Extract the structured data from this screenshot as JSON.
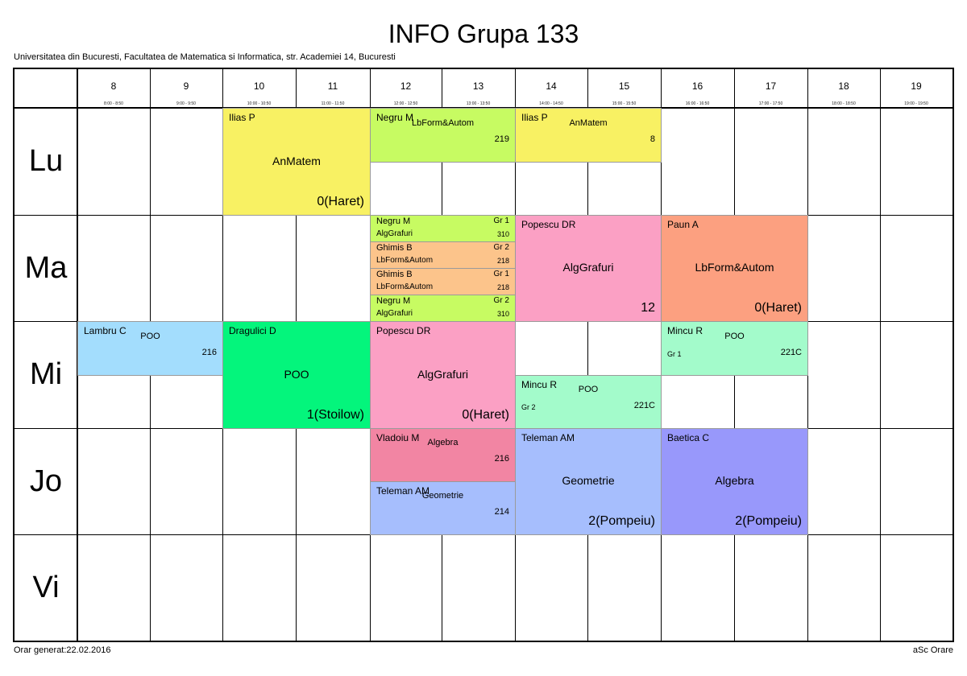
{
  "title": "INFO Grupa 133",
  "subtitle": "Universitatea din Bucuresti, Facultatea de Matematica si Informatica, str. Academiei 14, Bucuresti",
  "hours": [
    {
      "label": "8",
      "range": "8:00 - 8:50"
    },
    {
      "label": "9",
      "range": "9:00 - 9:50"
    },
    {
      "label": "10",
      "range": "10:00 - 10:50"
    },
    {
      "label": "11",
      "range": "11:00 - 11:50"
    },
    {
      "label": "12",
      "range": "12:00 - 12:50"
    },
    {
      "label": "13",
      "range": "13:00 - 13:50"
    },
    {
      "label": "14",
      "range": "14:00 - 14:50"
    },
    {
      "label": "15",
      "range": "15:00 - 15:50"
    },
    {
      "label": "16",
      "range": "16:00 - 16:50"
    },
    {
      "label": "17",
      "range": "17:00 - 17:50"
    },
    {
      "label": "18",
      "range": "18:00 - 18:50"
    },
    {
      "label": "19",
      "range": "19:00 - 19:50"
    }
  ],
  "days": [
    "Lu",
    "Ma",
    "Mi",
    "Jo",
    "Vi"
  ],
  "classes": [
    {
      "id": "lu-anmatem-1",
      "teacher": "Ilias P",
      "subject": "AnMatem",
      "room": "0(Haret)",
      "group": "",
      "color": "#f8f163"
    },
    {
      "id": "lu-lbform",
      "teacher": "Negru M",
      "subject": "LbForm&Autom",
      "room": "219",
      "group": "",
      "color": "#c7fb62"
    },
    {
      "id": "lu-anmatem-2",
      "teacher": "Ilias P",
      "subject": "AnMatem",
      "room": "8",
      "group": "",
      "color": "#f8f163"
    },
    {
      "id": "ma-alg-negru-1",
      "teacher": "Negru M",
      "subject": "AlgGrafuri",
      "room": "310",
      "group": "Gr 1",
      "color": "#c7fb62"
    },
    {
      "id": "ma-lbform-ghimis-2",
      "teacher": "Ghimis B",
      "subject": "LbForm&Autom",
      "room": "218",
      "group": "Gr 2",
      "color": "#fcc48b"
    },
    {
      "id": "ma-lbform-ghimis-1",
      "teacher": "Ghimis B",
      "subject": "LbForm&Autom",
      "room": "218",
      "group": "Gr 1",
      "color": "#fcc48b"
    },
    {
      "id": "ma-alg-negru-2",
      "teacher": "Negru M",
      "subject": "AlgGrafuri",
      "room": "310",
      "group": "Gr 2",
      "color": "#c7fb62"
    },
    {
      "id": "ma-alg-popescu",
      "teacher": "Popescu DR",
      "subject": "AlgGrafuri",
      "room": "12",
      "group": "",
      "color": "#fba0c4"
    },
    {
      "id": "ma-lbform-paun",
      "teacher": "Paun A",
      "subject": "LbForm&Autom",
      "room": "0(Haret)",
      "group": "",
      "color": "#fca080"
    },
    {
      "id": "mi-poo-lambru",
      "teacher": "Lambru C",
      "subject": "POO",
      "room": "216",
      "group": "",
      "color": "#a3ddfd"
    },
    {
      "id": "mi-poo-dragulici",
      "teacher": "Dragulici D",
      "subject": "POO",
      "room": "1(Stoilow)",
      "group": "",
      "color": "#04f57c"
    },
    {
      "id": "mi-alg-popescu",
      "teacher": "Popescu DR",
      "subject": "AlgGrafuri",
      "room": "0(Haret)",
      "group": "",
      "color": "#fba0c4"
    },
    {
      "id": "mi-poo-mincu-2",
      "teacher": "Mincu R",
      "subject": "POO",
      "room": "221C",
      "group": "Gr 2",
      "color": "#a3fbcb"
    },
    {
      "id": "mi-poo-mincu-1",
      "teacher": "Mincu R",
      "subject": "POO",
      "room": "221C",
      "group": "Gr 1",
      "color": "#a3fbcb"
    },
    {
      "id": "jo-algebra-vladoiu",
      "teacher": "Vladoiu M",
      "subject": "Algebra",
      "room": "216",
      "group": "",
      "color": "#f285a3"
    },
    {
      "id": "jo-geom-teleman-1",
      "teacher": "Teleman AM",
      "subject": "Geometrie",
      "room": "214",
      "group": "",
      "color": "#a6befd"
    },
    {
      "id": "jo-geom-teleman-2",
      "teacher": "Teleman AM",
      "subject": "Geometrie",
      "room": "2(Pompeiu)",
      "group": "",
      "color": "#a6befd"
    },
    {
      "id": "jo-algebra-baetica",
      "teacher": "Baetica C",
      "subject": "Algebra",
      "room": "2(Pompeiu)",
      "group": "",
      "color": "#9898fb"
    }
  ],
  "footer": {
    "generated": "Orar generat:22.02.2016",
    "brand": "aSc Orare"
  }
}
